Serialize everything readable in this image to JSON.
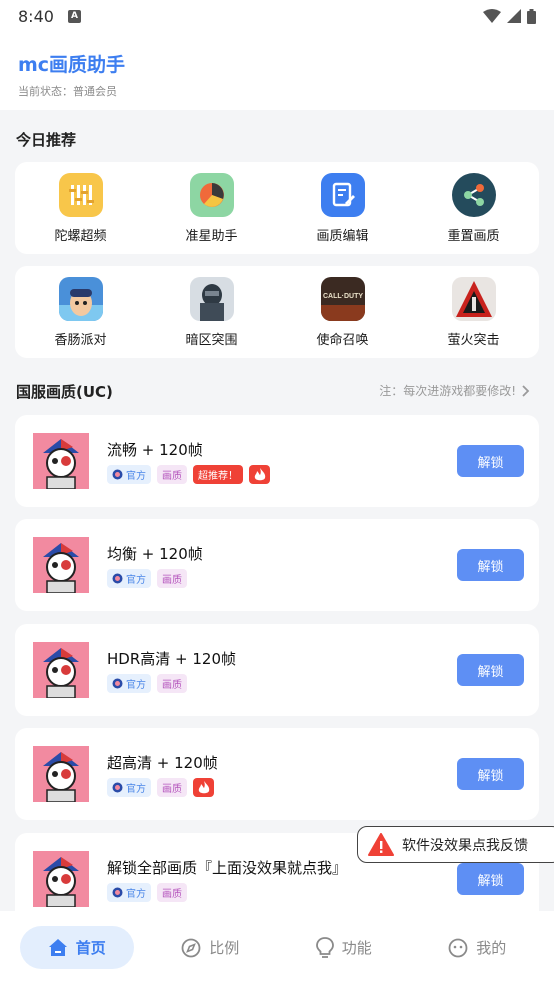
{
  "status_bar": {
    "time": "8:40",
    "notification_badge": "A"
  },
  "header": {
    "title": "mc画质助手",
    "subtitle": "当前状态：普通会员"
  },
  "today": {
    "title": "今日推荐",
    "tools": [
      {
        "label": "陀螺超频",
        "icon": "gyroscope-icon",
        "color": "#f8c64a"
      },
      {
        "label": "准星助手",
        "icon": "crosshair-icon",
        "color": "#8dd6a3"
      },
      {
        "label": "画质编辑",
        "icon": "edit-icon",
        "color": "#3d7ef0"
      },
      {
        "label": "重置画质",
        "icon": "share-icon",
        "color": "#244b5c"
      }
    ],
    "games": [
      {
        "label": "香肠派对",
        "icon": "sausage-party-icon"
      },
      {
        "label": "暗区突围",
        "icon": "arena-breakout-icon"
      },
      {
        "label": "使命召唤",
        "icon": "call-of-duty-icon",
        "logo_text": "CALL·DUTY"
      },
      {
        "label": "萤火突击",
        "icon": "firefly-icon"
      }
    ]
  },
  "presets_section": {
    "title": "国服画质(UC)",
    "notice": "注：每次进游戏都要修改!"
  },
  "tag_labels": {
    "official": "官方",
    "quality": "画质",
    "recommend": "超推荐！"
  },
  "presets": [
    {
      "title": "流畅 + 120帧",
      "unlock_label": "解锁",
      "hot": true,
      "fire": true
    },
    {
      "title": "均衡 + 120帧",
      "unlock_label": "解锁",
      "hot": false,
      "fire": false
    },
    {
      "title": "HDR高清 + 120帧",
      "unlock_label": "解锁",
      "hot": false,
      "fire": false
    },
    {
      "title": "超高清 + 120帧",
      "unlock_label": "解锁",
      "hot": false,
      "fire": true
    },
    {
      "title": "解锁全部画质『上面没效果就点我』",
      "unlock_label": "解锁",
      "hot": false,
      "fire": false
    }
  ],
  "toast": {
    "text": "软件没效果点我反馈"
  },
  "nav": [
    {
      "label": "首页",
      "icon": "home-icon",
      "active": true
    },
    {
      "label": "比例",
      "icon": "compass-icon",
      "active": false
    },
    {
      "label": "功能",
      "icon": "lightbulb-icon",
      "active": false
    },
    {
      "label": "我的",
      "icon": "face-icon",
      "active": false
    }
  ],
  "colors": {
    "accent": "#3d7ef0",
    "unlock": "#5e8ff4",
    "hot": "#ef4136"
  }
}
